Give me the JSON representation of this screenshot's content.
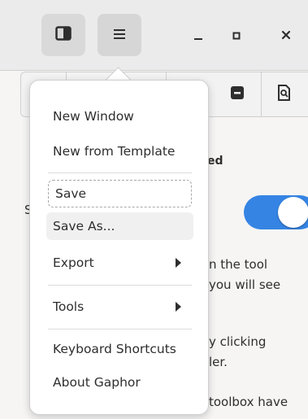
{
  "menu": {
    "items": [
      {
        "label": "New Window"
      },
      {
        "label": "New from Template"
      },
      {
        "label": "Save"
      },
      {
        "label": "Save As..."
      },
      {
        "label": "Export"
      },
      {
        "label": "Tools"
      },
      {
        "label": "Keyboard Shortcuts"
      },
      {
        "label": "About Gaphor"
      }
    ]
  },
  "background": {
    "heading_fragment": "ed",
    "s_fragment": "S",
    "line1": "n the tool",
    "line2": "you will see",
    "line3": "y clicking",
    "line4": "ler.",
    "line5": "toolbox have"
  },
  "icons": {
    "sidebar": "sidebar-toggle-icon",
    "menu": "hamburger-menu-icon",
    "minimize": "minimize-icon",
    "maximize": "maximize-icon",
    "close": "close-icon"
  },
  "colors": {
    "accent": "#3584e4"
  }
}
